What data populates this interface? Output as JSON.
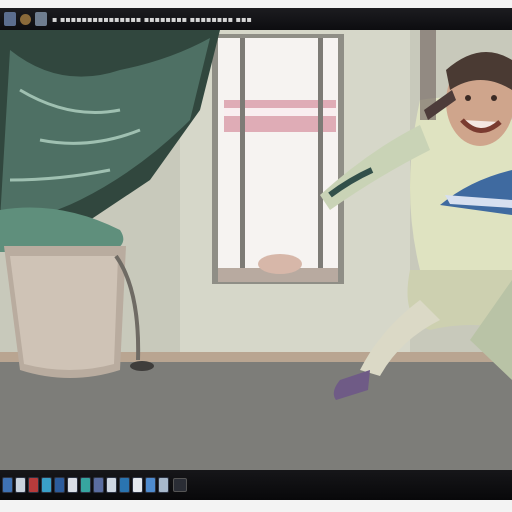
{
  "window": {
    "title": "▪ ▪▪▪▪▪▪▪▪▪▪▪▪▪▪▪ ▪▪▪▪▪▪▪▪ ▪▪▪▪▪▪▪▪ ▪▪▪",
    "titlebar_icons": [
      "app-icon",
      "media-icon",
      "file-icon"
    ]
  },
  "scene": {
    "description_icons": [
      "potted-plant",
      "window",
      "child-figure"
    ]
  },
  "taskbar": {
    "buttons": [
      {
        "name": "task-button-1",
        "color": "#3f72b4"
      },
      {
        "name": "task-button-2",
        "color": "#c9d3de"
      },
      {
        "name": "task-button-3",
        "color": "#b63b3b"
      },
      {
        "name": "task-button-4",
        "color": "#3aa0c8"
      },
      {
        "name": "task-button-5",
        "color": "#2c5c9c"
      },
      {
        "name": "task-button-6",
        "color": "#d9dee6"
      },
      {
        "name": "task-button-7",
        "color": "#37a5a0"
      },
      {
        "name": "task-button-8",
        "color": "#5a6da0"
      },
      {
        "name": "task-button-9",
        "color": "#cfd7e2"
      },
      {
        "name": "task-button-10",
        "color": "#2a74b0"
      },
      {
        "name": "task-button-11",
        "color": "#e3e8ee"
      },
      {
        "name": "task-button-12",
        "color": "#4e8bcf"
      },
      {
        "name": "task-button-13",
        "color": "#a7b8cc"
      }
    ]
  }
}
